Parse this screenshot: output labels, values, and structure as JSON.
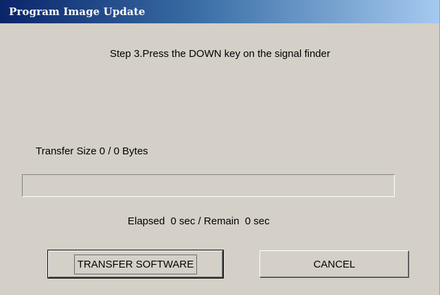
{
  "window": {
    "title": "Program Image Update"
  },
  "dialog": {
    "step_text": "Step 3.Press the DOWN key on the signal finder",
    "transfer_size_text": "Transfer Size 0 / 0 Bytes",
    "elapsed_text": "Elapsed  0 sec / Remain  0 sec",
    "progress_fraction": 0
  },
  "buttons": {
    "transfer_label": "TRANSFER SOFTWARE",
    "cancel_label": "CANCEL"
  },
  "colors": {
    "title_gradient_start": "#0a246a",
    "title_gradient_end": "#a6caf0",
    "dialog_background": "#d4d0c8",
    "title_text": "#ffffff"
  }
}
